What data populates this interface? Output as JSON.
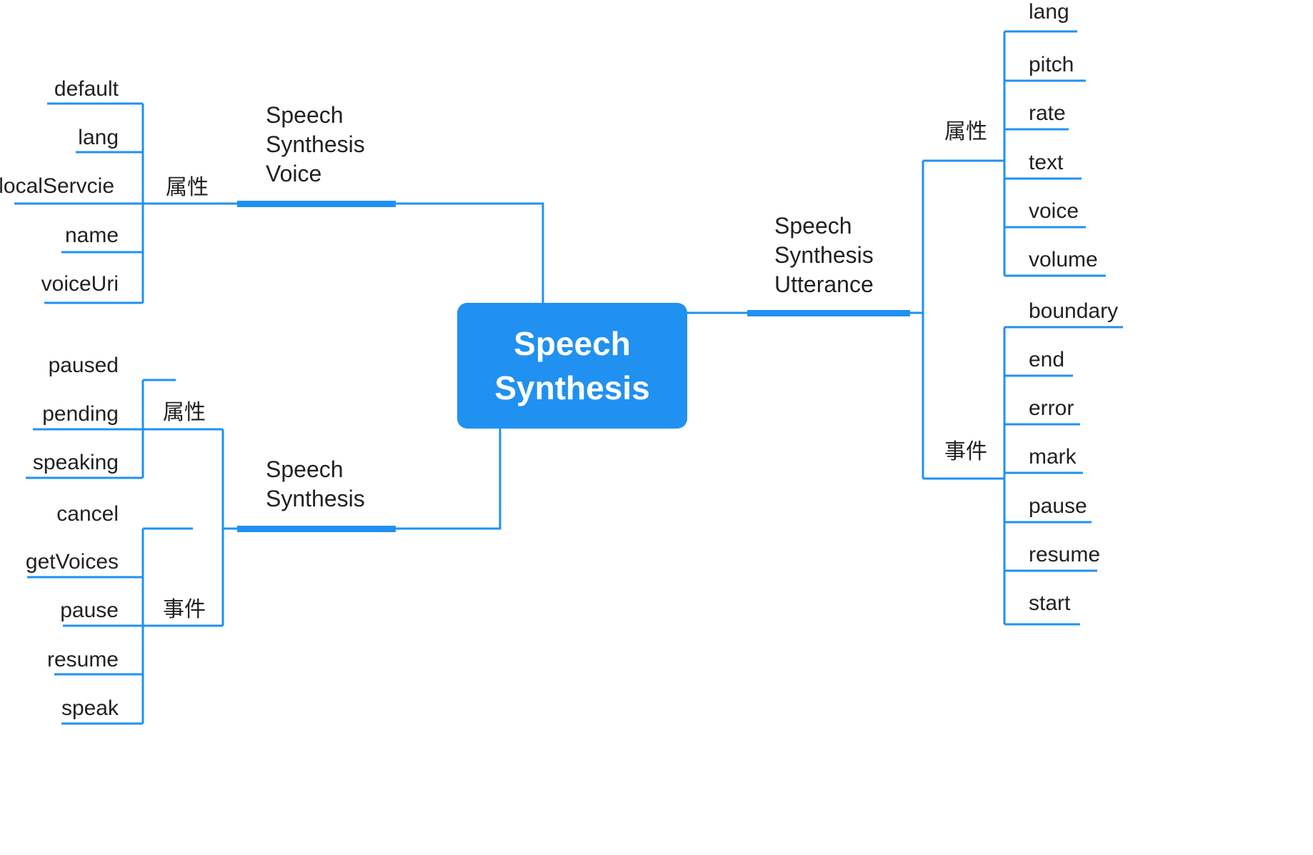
{
  "colors": {
    "accent": "#2091f0",
    "line": "#2091f0",
    "text": "#231f20",
    "node_text": "#ffffff",
    "background": "#ffffff"
  },
  "center": {
    "label": "Speech\nSynthesis"
  },
  "branches": [
    {
      "id": "speech-synthesis-voice",
      "label": "Speech\nSynthesis\nVoice",
      "side": "left",
      "categories": [
        {
          "id": "voice-attributes",
          "label": "属性",
          "items": [
            "default",
            "lang",
            "localServcie",
            "name",
            "voiceUri"
          ]
        }
      ]
    },
    {
      "id": "speech-synthesis",
      "label": "Speech\nSynthesis",
      "side": "left",
      "categories": [
        {
          "id": "synthesis-attributes",
          "label": "属性",
          "items": [
            "paused",
            "pending",
            "speaking"
          ]
        },
        {
          "id": "synthesis-events",
          "label": "事件",
          "items": [
            "cancel",
            "getVoices",
            "pause",
            "resume",
            "speak"
          ]
        }
      ]
    },
    {
      "id": "speech-synthesis-utterance",
      "label": "Speech\nSynthesis\nUtterance",
      "side": "right",
      "categories": [
        {
          "id": "utterance-attributes",
          "label": "属性",
          "items": [
            "lang",
            "pitch",
            "rate",
            "text",
            "voice",
            "volume"
          ]
        },
        {
          "id": "utterance-events",
          "label": "事件",
          "items": [
            "boundary",
            "end",
            "error",
            "mark",
            "pause",
            "resume",
            "start"
          ]
        }
      ]
    }
  ],
  "labels": {
    "voice_title": "Speech\nSynthesis\nVoice",
    "synthesis_title": "Speech\nSynthesis",
    "utterance_title": "Speech\nSynthesis\nUtterance",
    "attr_voice": "属性",
    "attr_synthesis": "属性",
    "event_synthesis": "事件",
    "attr_utterance": "属性",
    "event_utterance": "事件",
    "voice_items": {
      "i0": "default",
      "i1": "lang",
      "i2": "localServcie",
      "i3": "name",
      "i4": "voiceUri"
    },
    "synth_attr_items": {
      "i0": "paused",
      "i1": "pending",
      "i2": "speaking"
    },
    "synth_event_items": {
      "i0": "cancel",
      "i1": "getVoices",
      "i2": "pause",
      "i3": "resume",
      "i4": "speak"
    },
    "utt_attr_items": {
      "i0": "lang",
      "i1": "pitch",
      "i2": "rate",
      "i3": "text",
      "i4": "voice",
      "i5": "volume"
    },
    "utt_event_items": {
      "i0": "boundary",
      "i1": "end",
      "i2": "error",
      "i3": "mark",
      "i4": "pause",
      "i5": "resume",
      "i6": "start"
    }
  }
}
